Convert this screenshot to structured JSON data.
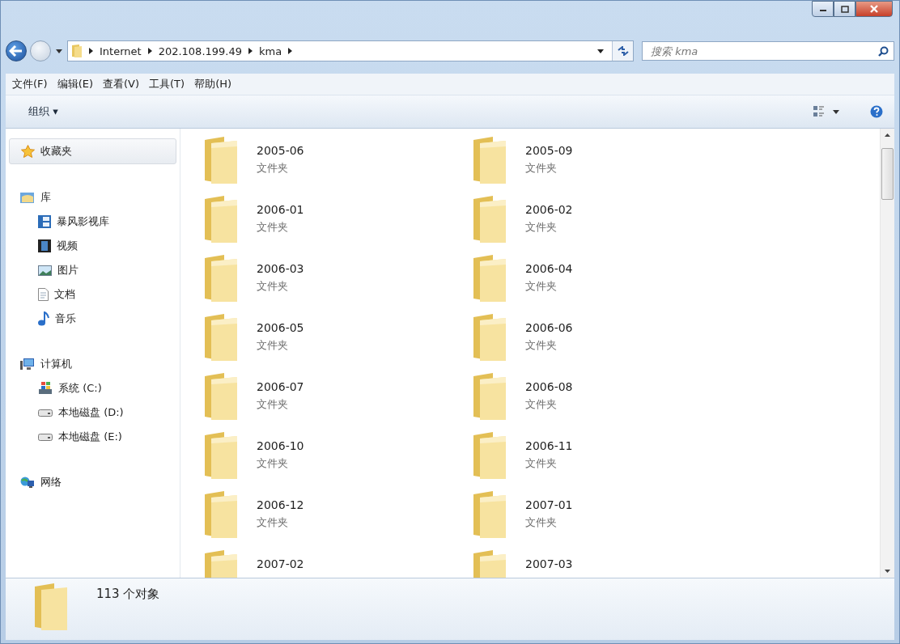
{
  "address": {
    "segments": [
      "Internet",
      "202.108.199.49",
      "kma"
    ]
  },
  "search": {
    "placeholder": "搜索 kma"
  },
  "menu": [
    "文件(F)",
    "编辑(E)",
    "查看(V)",
    "工具(T)",
    "帮助(H)"
  ],
  "toolbar": {
    "organize": "组织 ▾"
  },
  "sidebar": [
    {
      "label": "收藏夹",
      "kind": "favorites",
      "selected": true
    },
    {
      "label": "库",
      "kind": "library",
      "selected": false,
      "children": [
        {
          "label": "暴风影视库",
          "kind": "media"
        },
        {
          "label": "视频",
          "kind": "video"
        },
        {
          "label": "图片",
          "kind": "picture"
        },
        {
          "label": "文档",
          "kind": "document"
        },
        {
          "label": "音乐",
          "kind": "music"
        }
      ]
    },
    {
      "label": "计算机",
      "kind": "computer",
      "selected": false,
      "children": [
        {
          "label": "系统 (C:)",
          "kind": "system-drive"
        },
        {
          "label": "本地磁盘 (D:)",
          "kind": "drive"
        },
        {
          "label": "本地磁盘 (E:)",
          "kind": "drive"
        }
      ]
    },
    {
      "label": "网络",
      "kind": "network",
      "selected": false
    }
  ],
  "files": [
    {
      "name": "2005-06",
      "type": "文件夹"
    },
    {
      "name": "2005-09",
      "type": "文件夹"
    },
    {
      "name": "2006-01",
      "type": "文件夹"
    },
    {
      "name": "2006-02",
      "type": "文件夹"
    },
    {
      "name": "2006-03",
      "type": "文件夹"
    },
    {
      "name": "2006-04",
      "type": "文件夹"
    },
    {
      "name": "2006-05",
      "type": "文件夹"
    },
    {
      "name": "2006-06",
      "type": "文件夹"
    },
    {
      "name": "2006-07",
      "type": "文件夹"
    },
    {
      "name": "2006-08",
      "type": "文件夹"
    },
    {
      "name": "2006-10",
      "type": "文件夹"
    },
    {
      "name": "2006-11",
      "type": "文件夹"
    },
    {
      "name": "2006-12",
      "type": "文件夹"
    },
    {
      "name": "2007-01",
      "type": "文件夹"
    },
    {
      "name": "2007-02"
    },
    {
      "name": "2007-03"
    }
  ],
  "status_bar": {
    "count": "113 个对象"
  }
}
